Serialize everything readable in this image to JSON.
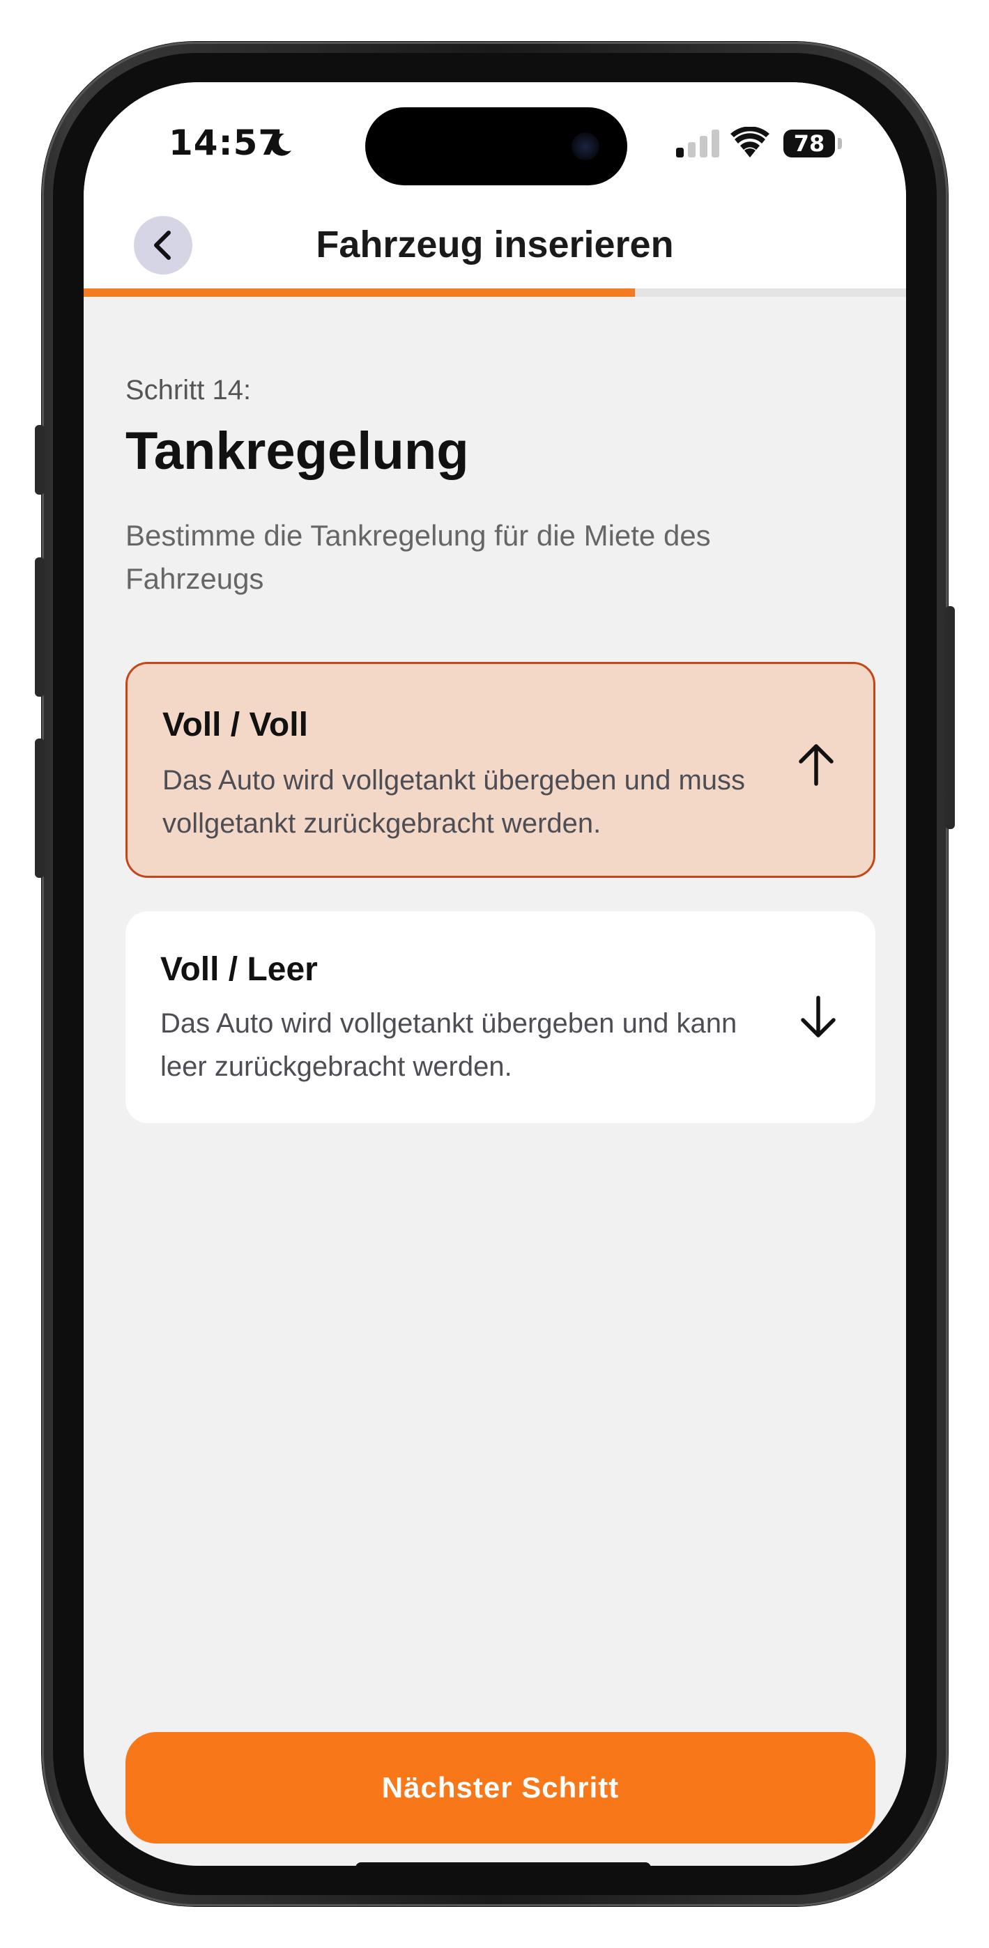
{
  "status_bar": {
    "time": "14:57",
    "battery": "78"
  },
  "header": {
    "title": "Fahrzeug inserieren",
    "progress_percent": 67
  },
  "content": {
    "step_label": "Schritt 14:",
    "title": "Tankregelung",
    "subtitle": "Bestimme die Tankregelung für die Miete des Fahrzeugs"
  },
  "options": [
    {
      "title": "Voll / Voll",
      "description": "Das Auto wird vollgetankt übergeben und muss vollgetankt zurückgebracht werden.",
      "selected": true,
      "icon": "arrow-up-icon"
    },
    {
      "title": "Voll / Leer",
      "description": "Das Auto wird vollgetankt übergeben und kann leer zurückgebracht werden.",
      "selected": false,
      "icon": "arrow-down-icon"
    }
  ],
  "footer": {
    "next_label": "Nächster Schritt"
  },
  "colors": {
    "accent": "#f77719",
    "selected_bg": "#f3d8c8",
    "selected_border": "#c4461b"
  }
}
